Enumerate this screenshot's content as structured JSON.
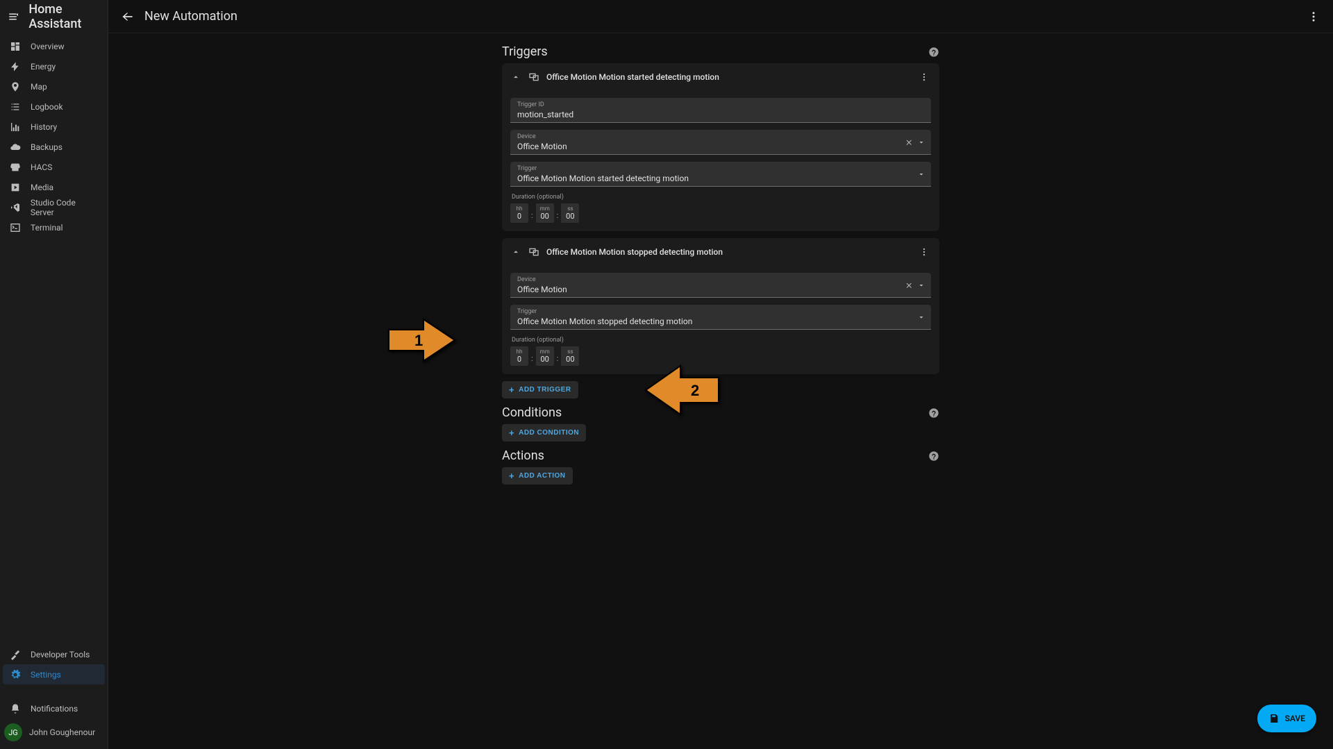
{
  "app": {
    "title": "Home Assistant",
    "page_title": "New Automation"
  },
  "sidebar": {
    "items": [
      {
        "label": "Overview"
      },
      {
        "label": "Energy"
      },
      {
        "label": "Map"
      },
      {
        "label": "Logbook"
      },
      {
        "label": "History"
      },
      {
        "label": "Backups"
      },
      {
        "label": "HACS"
      },
      {
        "label": "Media"
      },
      {
        "label": "Studio Code Server"
      },
      {
        "label": "Terminal"
      }
    ],
    "devtools_label": "Developer Tools",
    "settings_label": "Settings",
    "notifications_label": "Notifications",
    "user_name": "John Goughenour",
    "user_initials": "JG"
  },
  "sections": {
    "triggers_title": "Triggers",
    "conditions_title": "Conditions",
    "actions_title": "Actions"
  },
  "triggers": [
    {
      "title": "Office Motion Motion started detecting motion",
      "trigger_id_label": "Trigger ID",
      "trigger_id_value": "motion_started",
      "device_label": "Device",
      "device_value": "Office Motion",
      "trigger_label": "Trigger",
      "trigger_value": "Office Motion Motion started detecting motion",
      "duration_label": "Duration (optional)",
      "duration": {
        "hh_label": "hh",
        "hh": "0",
        "mm_label": "mm",
        "mm": "00",
        "ss_label": "ss",
        "ss": "00"
      }
    },
    {
      "title": "Office Motion Motion stopped detecting motion",
      "device_label": "Device",
      "device_value": "Office Motion",
      "trigger_label": "Trigger",
      "trigger_value": "Office Motion Motion stopped detecting motion",
      "duration_label": "Duration (optional)",
      "duration": {
        "hh_label": "hh",
        "hh": "0",
        "mm_label": "mm",
        "mm": "00",
        "ss_label": "ss",
        "ss": "00"
      }
    }
  ],
  "buttons": {
    "add_trigger": "ADD TRIGGER",
    "add_condition": "ADD CONDITION",
    "add_action": "ADD ACTION",
    "save": "SAVE"
  },
  "annotations": {
    "arrow1_label": "1",
    "arrow2_label": "2"
  }
}
